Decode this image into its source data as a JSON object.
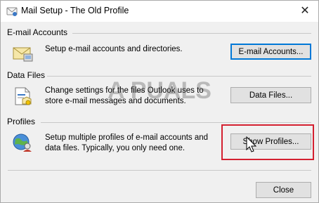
{
  "window": {
    "title": "Mail Setup - The Old Profile"
  },
  "sections": [
    {
      "label": "E-mail Accounts",
      "description": "Setup e-mail accounts and directories.",
      "button": "E-mail Accounts..."
    },
    {
      "label": "Data Files",
      "description_lines": [
        "Change settings for the files Outlook uses to",
        "store e-mail messages and documents."
      ],
      "button": "Data Files..."
    },
    {
      "label": "Profiles",
      "description_lines": [
        "Setup multiple profiles of e-mail accounts and",
        "data files. Typically, you only need one."
      ],
      "button": "Show Profiles..."
    }
  ],
  "footer": {
    "close_label": "Close"
  },
  "colors": {
    "highlight": "#d42030",
    "default_button_border": "#0078d7"
  },
  "watermark": {
    "text": "A PUALS"
  }
}
